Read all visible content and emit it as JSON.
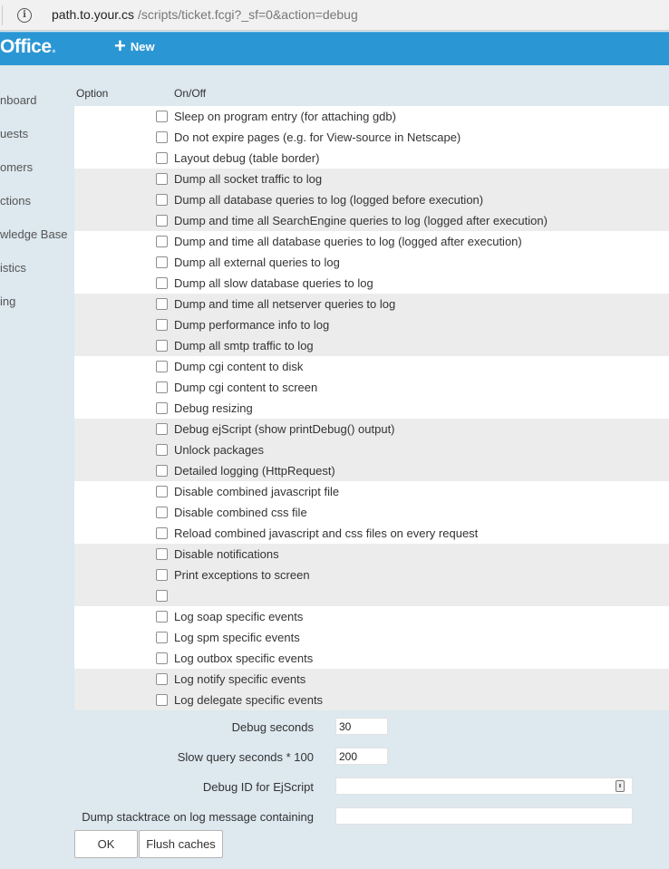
{
  "browser": {
    "url_host": "path.to.your.cs",
    "url_path": "/scripts/ticket.fcgi?_sf=0&action=debug"
  },
  "header": {
    "logo": "Office",
    "logo_dot": ".",
    "new_label": "New"
  },
  "sidebar": {
    "items": [
      "nboard",
      "uests",
      "omers",
      "ctions",
      "wledge Base",
      "istics",
      "ing"
    ]
  },
  "table": {
    "col_option": "Option",
    "col_onoff": "On/Off",
    "rows": [
      "Sleep on program entry (for attaching gdb)",
      "Do not expire pages (e.g. for View-source in Netscape)",
      "Layout debug (table border)",
      "Dump all socket traffic to log",
      "Dump all database queries to log (logged before execution)",
      "Dump and time all SearchEngine queries to log (logged after execution)",
      "Dump and time all database queries to log (logged after execution)",
      "Dump all external queries to log",
      "Dump all slow database queries to log",
      "Dump and time all netserver queries to log",
      "Dump performance info to log",
      "Dump all smtp traffic to log",
      "Dump cgi content to disk",
      "Dump cgi content to screen",
      "Debug resizing",
      "Debug ejScript (show printDebug() output)",
      "Unlock packages",
      "Detailed logging (HttpRequest)",
      "Disable combined javascript file",
      "Disable combined css file",
      "Reload combined javascript and css files on every request",
      "Disable notifications",
      "Print exceptions to screen",
      "",
      "Log soap specific events",
      "Log spm specific events",
      "Log outbox specific events",
      "Log notify specific events",
      "Log delegate specific events"
    ]
  },
  "fields": {
    "debug_seconds_label": "Debug seconds",
    "debug_seconds_value": "30",
    "slow_query_label": "Slow query seconds * 100",
    "slow_query_value": "200",
    "debug_id_label": "Debug ID for EjScript",
    "debug_id_value": "",
    "stacktrace_label": "Dump stacktrace on log message containing",
    "stacktrace_value": ""
  },
  "buttons": {
    "ok": "OK",
    "flush": "Flush caches"
  }
}
